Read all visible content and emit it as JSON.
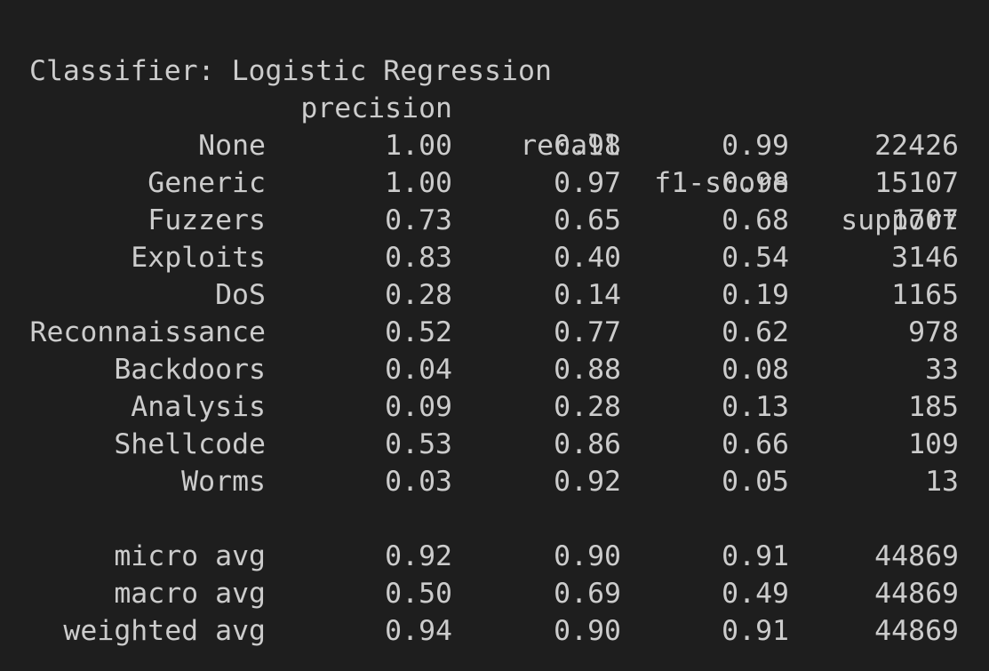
{
  "report": {
    "title": "Classifier: Logistic Regression",
    "headers": {
      "precision": "precision",
      "recall": "recall",
      "f1": "f1-score",
      "support": "support"
    },
    "rows": [
      {
        "label": "None",
        "precision": "1.00",
        "recall": "0.98",
        "f1": "0.99",
        "support": "22426"
      },
      {
        "label": "Generic",
        "precision": "1.00",
        "recall": "0.97",
        "f1": "0.98",
        "support": "15107"
      },
      {
        "label": "Fuzzers",
        "precision": "0.73",
        "recall": "0.65",
        "f1": "0.68",
        "support": "1707"
      },
      {
        "label": "Exploits",
        "precision": "0.83",
        "recall": "0.40",
        "f1": "0.54",
        "support": "3146"
      },
      {
        "label": "DoS",
        "precision": "0.28",
        "recall": "0.14",
        "f1": "0.19",
        "support": "1165"
      },
      {
        "label": "Reconnaissance",
        "precision": "0.52",
        "recall": "0.77",
        "f1": "0.62",
        "support": "978"
      },
      {
        "label": "Backdoors",
        "precision": "0.04",
        "recall": "0.88",
        "f1": "0.08",
        "support": "33"
      },
      {
        "label": "Analysis",
        "precision": "0.09",
        "recall": "0.28",
        "f1": "0.13",
        "support": "185"
      },
      {
        "label": "Shellcode",
        "precision": "0.53",
        "recall": "0.86",
        "f1": "0.66",
        "support": "109"
      },
      {
        "label": "Worms",
        "precision": "0.03",
        "recall": "0.92",
        "f1": "0.05",
        "support": "13"
      }
    ],
    "averages": [
      {
        "label": "micro avg",
        "precision": "0.92",
        "recall": "0.90",
        "f1": "0.91",
        "support": "44869"
      },
      {
        "label": "macro avg",
        "precision": "0.50",
        "recall": "0.69",
        "f1": "0.49",
        "support": "44869"
      },
      {
        "label": "weighted avg",
        "precision": "0.94",
        "recall": "0.90",
        "f1": "0.91",
        "support": "44869"
      }
    ]
  }
}
